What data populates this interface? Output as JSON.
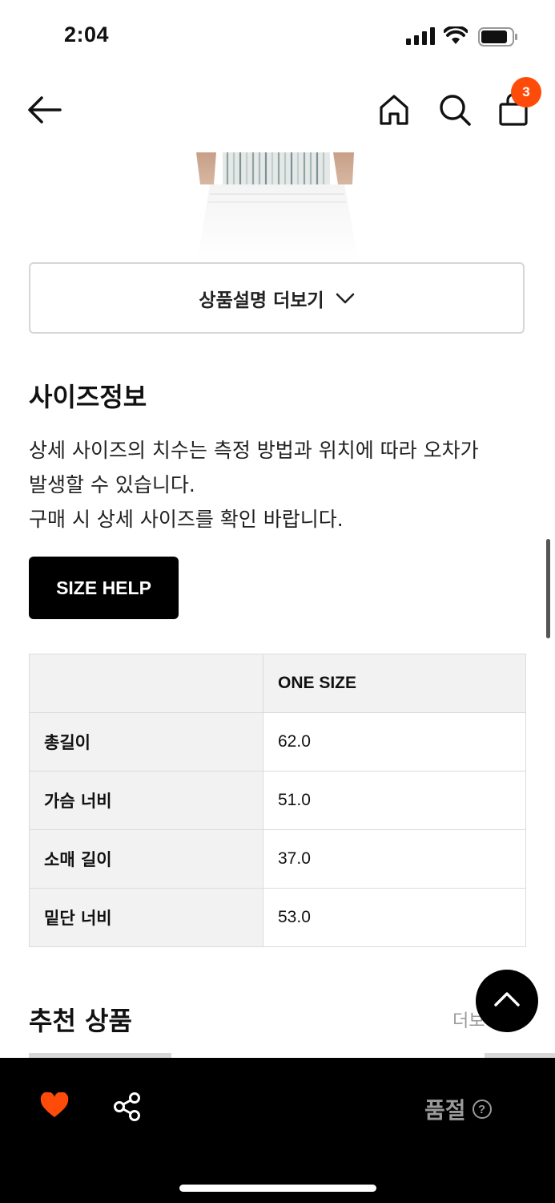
{
  "status_bar": {
    "time": "2:04"
  },
  "header": {
    "cart_count": "3"
  },
  "product": {
    "more_button_label": "상품설명 더보기"
  },
  "size_info": {
    "title": "사이즈정보",
    "description_lines": [
      "상세 사이즈의 치수는 측정 방법과 위치에 따라 오차가",
      "발생할 수 있습니다.",
      "구매 시 상세 사이즈를 확인 바랍니다."
    ],
    "size_help_label": "SIZE HELP",
    "table": {
      "column_header": "ONE SIZE",
      "rows": [
        {
          "label": "총길이",
          "value": "62.0"
        },
        {
          "label": "가슴 너비",
          "value": "51.0"
        },
        {
          "label": "소매 길이",
          "value": "37.0"
        },
        {
          "label": "밑단 너비",
          "value": "53.0"
        }
      ]
    }
  },
  "recommended": {
    "title": "추천 상품",
    "more_label": "더보"
  },
  "bottom_bar": {
    "soldout_label": "품절",
    "help_glyph": "?"
  },
  "colors": {
    "accent": "#ff4b0a",
    "bottom_bar": "#000000",
    "table_header_bg": "#f2f2f2"
  }
}
